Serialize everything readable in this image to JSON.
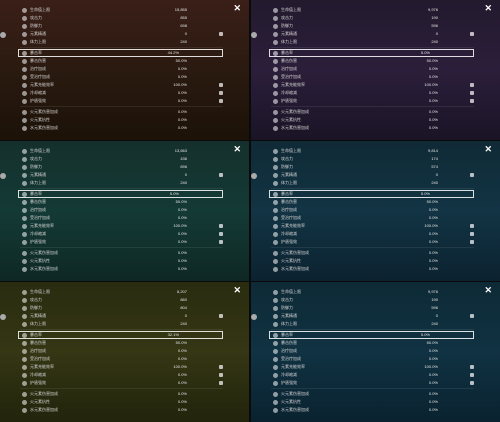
{
  "panels": [
    {
      "bg": "linear-gradient(180deg,#3a1f18 0%,#2a1a10 50%,#1c1208 100%)",
      "sel_value": "44.2%",
      "rows_a": [
        {
          "label": "生命值上限",
          "value": "15,855",
          "lock": false
        },
        {
          "label": "攻击力",
          "value": "855",
          "lock": false
        },
        {
          "label": "防御力",
          "value": "698",
          "lock": false
        },
        {
          "label": "元素精通",
          "value": "0",
          "lock": true
        },
        {
          "label": "体力上限",
          "value": "240",
          "lock": false
        }
      ],
      "rows_b": [
        {
          "label": "暴击伤害",
          "value": "50.0%",
          "lock": false
        },
        {
          "label": "治疗加成",
          "value": "0.0%",
          "lock": false
        },
        {
          "label": "受治疗加成",
          "value": "0.0%",
          "lock": false
        },
        {
          "label": "元素充能效率",
          "value": "100.0%",
          "lock": true
        },
        {
          "label": "冷却缩减",
          "value": "0.0%",
          "lock": true
        },
        {
          "label": "护盾强效",
          "value": "0.0%",
          "lock": true
        }
      ],
      "rows_c": [
        {
          "label": "火元素伤害加成",
          "value": "0.0%",
          "lock": false
        },
        {
          "label": "火元素抗性",
          "value": "0.0%",
          "lock": false
        },
        {
          "label": "水元素伤害加成",
          "value": "0.0%",
          "lock": false
        }
      ]
    },
    {
      "bg": "linear-gradient(180deg,#231a2e 0%,#2b1e3a 50%,#1a1426 100%)",
      "sel_value": "5.0%",
      "rows_a": [
        {
          "label": "生命值上限",
          "value": "9,976",
          "lock": false
        },
        {
          "label": "攻击力",
          "value": "190",
          "lock": false
        },
        {
          "label": "防御力",
          "value": "596",
          "lock": false
        },
        {
          "label": "元素精通",
          "value": "0",
          "lock": true
        },
        {
          "label": "体力上限",
          "value": "240",
          "lock": false
        }
      ],
      "rows_b": [
        {
          "label": "暴击伤害",
          "value": "50.0%",
          "lock": false
        },
        {
          "label": "治疗加成",
          "value": "0.0%",
          "lock": false
        },
        {
          "label": "受治疗加成",
          "value": "0.0%",
          "lock": false
        },
        {
          "label": "元素充能效率",
          "value": "100.0%",
          "lock": true
        },
        {
          "label": "冷却缩减",
          "value": "0.0%",
          "lock": true
        },
        {
          "label": "护盾强效",
          "value": "0.0%",
          "lock": true
        }
      ],
      "rows_c": [
        {
          "label": "火元素伤害加成",
          "value": "0.0%",
          "lock": false
        },
        {
          "label": "火元素抗性",
          "value": "0.0%",
          "lock": false
        },
        {
          "label": "水元素伤害加成",
          "value": "0.0%",
          "lock": false
        }
      ]
    },
    {
      "bg": "linear-gradient(180deg,#15302c 0%,#143a36 50%,#0e2824 100%)",
      "sel_value": "5.0%",
      "rows_a": [
        {
          "label": "生命值上限",
          "value": "13,663",
          "lock": false
        },
        {
          "label": "攻击力",
          "value": "436",
          "lock": false
        },
        {
          "label": "防御力",
          "value": "896",
          "lock": false
        },
        {
          "label": "元素精通",
          "value": "0",
          "lock": true
        },
        {
          "label": "体力上限",
          "value": "240",
          "lock": false
        }
      ],
      "rows_b": [
        {
          "label": "暴击伤害",
          "value": "50.0%",
          "lock": false
        },
        {
          "label": "治疗加成",
          "value": "0.0%",
          "lock": false
        },
        {
          "label": "受治疗加成",
          "value": "0.0%",
          "lock": false
        },
        {
          "label": "元素充能效率",
          "value": "100.0%",
          "lock": true
        },
        {
          "label": "冷却缩减",
          "value": "0.0%",
          "lock": true
        },
        {
          "label": "护盾强效",
          "value": "0.0%",
          "lock": true
        }
      ],
      "rows_c": [
        {
          "label": "火元素伤害加成",
          "value": "0.0%",
          "lock": false
        },
        {
          "label": "火元素抗性",
          "value": "0.0%",
          "lock": false
        },
        {
          "label": "水元素伤害加成",
          "value": "0.0%",
          "lock": false
        }
      ]
    },
    {
      "bg": "linear-gradient(180deg,#102a36 0%,#123444 50%,#0c2230 100%)",
      "sel_value": "5.0%",
      "rows_a": [
        {
          "label": "生命值上限",
          "value": "9,814",
          "lock": false
        },
        {
          "label": "攻击力",
          "value": "174",
          "lock": false
        },
        {
          "label": "防御力",
          "value": "574",
          "lock": false
        },
        {
          "label": "元素精通",
          "value": "0",
          "lock": true
        },
        {
          "label": "体力上限",
          "value": "240",
          "lock": false
        }
      ],
      "rows_b": [
        {
          "label": "暴击伤害",
          "value": "50.0%",
          "lock": false
        },
        {
          "label": "治疗加成",
          "value": "0.0%",
          "lock": false
        },
        {
          "label": "受治疗加成",
          "value": "0.0%",
          "lock": false
        },
        {
          "label": "元素充能效率",
          "value": "100.0%",
          "lock": true
        },
        {
          "label": "冷却缩减",
          "value": "0.0%",
          "lock": true
        },
        {
          "label": "护盾强效",
          "value": "0.0%",
          "lock": true
        }
      ],
      "rows_c": [
        {
          "label": "火元素伤害加成",
          "value": "0.0%",
          "lock": false
        },
        {
          "label": "火元素抗性",
          "value": "0.0%",
          "lock": false
        },
        {
          "label": "水元素伤害加成",
          "value": "0.0%",
          "lock": false
        }
      ]
    },
    {
      "bg": "linear-gradient(180deg,#2a2c10 0%,#343614 50%,#22240c 100%)",
      "sel_value": "32.1%",
      "rows_a": [
        {
          "label": "生命值上限",
          "value": "8,207",
          "lock": false
        },
        {
          "label": "攻击力",
          "value": "860",
          "lock": false
        },
        {
          "label": "防御力",
          "value": "804",
          "lock": false
        },
        {
          "label": "元素精通",
          "value": "0",
          "lock": true
        },
        {
          "label": "体力上限",
          "value": "240",
          "lock": false
        }
      ],
      "rows_b": [
        {
          "label": "暴击伤害",
          "value": "50.0%",
          "lock": false
        },
        {
          "label": "治疗加成",
          "value": "0.0%",
          "lock": false
        },
        {
          "label": "受治疗加成",
          "value": "0.0%",
          "lock": false
        },
        {
          "label": "元素充能效率",
          "value": "100.0%",
          "lock": true
        },
        {
          "label": "冷却缩减",
          "value": "0.0%",
          "lock": true
        },
        {
          "label": "护盾强效",
          "value": "0.0%",
          "lock": true
        }
      ],
      "rows_c": [
        {
          "label": "火元素伤害加成",
          "value": "0.0%",
          "lock": false
        },
        {
          "label": "火元素抗性",
          "value": "0.0%",
          "lock": false
        },
        {
          "label": "水元素伤害加成",
          "value": "0.0%",
          "lock": false
        }
      ]
    },
    {
      "bg": "linear-gradient(180deg,#0e2a36 0%,#103242 50%,#0a2230 100%)",
      "sel_value": "5.0%",
      "rows_a": [
        {
          "label": "生命值上限",
          "value": "9,976",
          "lock": false
        },
        {
          "label": "攻击力",
          "value": "190",
          "lock": false
        },
        {
          "label": "防御力",
          "value": "596",
          "lock": false
        },
        {
          "label": "元素精通",
          "value": "0",
          "lock": true
        },
        {
          "label": "体力上限",
          "value": "240",
          "lock": false
        }
      ],
      "rows_b": [
        {
          "label": "暴击伤害",
          "value": "50.0%",
          "lock": false
        },
        {
          "label": "治疗加成",
          "value": "0.0%",
          "lock": false
        },
        {
          "label": "受治疗加成",
          "value": "0.0%",
          "lock": false
        },
        {
          "label": "元素充能效率",
          "value": "100.0%",
          "lock": true
        },
        {
          "label": "冷却缩减",
          "value": "0.0%",
          "lock": true
        },
        {
          "label": "护盾强效",
          "value": "0.0%",
          "lock": true
        }
      ],
      "rows_c": [
        {
          "label": "火元素伤害加成",
          "value": "0.0%",
          "lock": false
        },
        {
          "label": "火元素抗性",
          "value": "0.0%",
          "lock": false
        },
        {
          "label": "水元素伤害加成",
          "value": "0.0%",
          "lock": false
        }
      ]
    }
  ],
  "sel_label": "暴击率",
  "close_glyph": "✕"
}
